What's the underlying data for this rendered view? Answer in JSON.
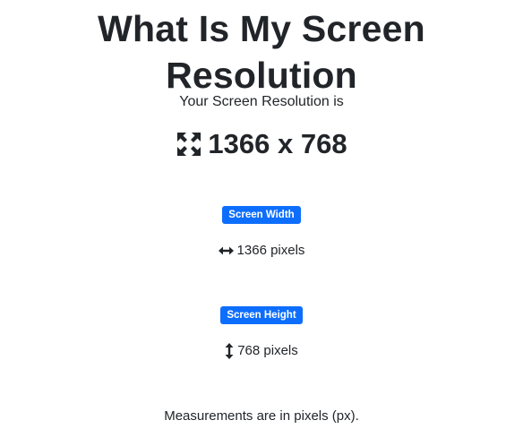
{
  "header": {
    "title": "What Is My Screen Resolution"
  },
  "resolution": {
    "subtitle": "Your Screen Resolution is",
    "display": "1366 x 768",
    "icon": "expand-arrows-icon"
  },
  "width": {
    "badge_label": "Screen Width",
    "value_text": "1366 pixels",
    "icon": "arrows-left-right-icon"
  },
  "height": {
    "badge_label": "Screen Height",
    "value_text": "768 pixels",
    "icon": "arrows-up-down-icon"
  },
  "footer": {
    "note": "Measurements are in pixels (px)."
  },
  "colors": {
    "badge_background": "#0d6efd",
    "text": "#212529",
    "background": "#ffffff"
  }
}
